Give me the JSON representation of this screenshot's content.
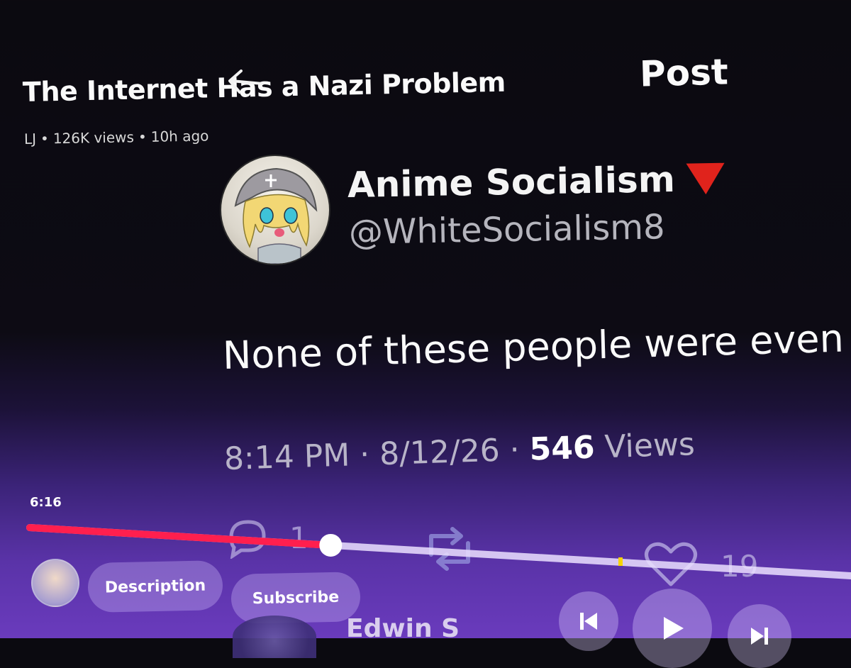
{
  "video": {
    "title": "The Internet Has a Nazi Problem",
    "channel": "LJ",
    "views": "126K views",
    "age": "10h ago",
    "separator": "•"
  },
  "post_header": {
    "title": "Post",
    "back_icon": "arrow-left-icon"
  },
  "tweet": {
    "author_name": "Anime Socialism",
    "badge_icon": "red-triangle-icon",
    "badge_color": "#e0231c",
    "handle": "@WhiteSocialism8",
    "text": "None of these people were even",
    "time": "8:14 PM",
    "date": "8/12/26",
    "views_count": "546",
    "views_label": "Views",
    "reply_count": "1",
    "like_count": "19"
  },
  "player": {
    "current_time": "6:16",
    "progress_fraction": 0.39,
    "accent_color": "#ff1f4e",
    "description_label": "Description",
    "subscribe_label": "Subscribe",
    "up_next_name": "Edwin S",
    "controls": [
      "previous-icon",
      "play-icon",
      "next-icon"
    ]
  }
}
